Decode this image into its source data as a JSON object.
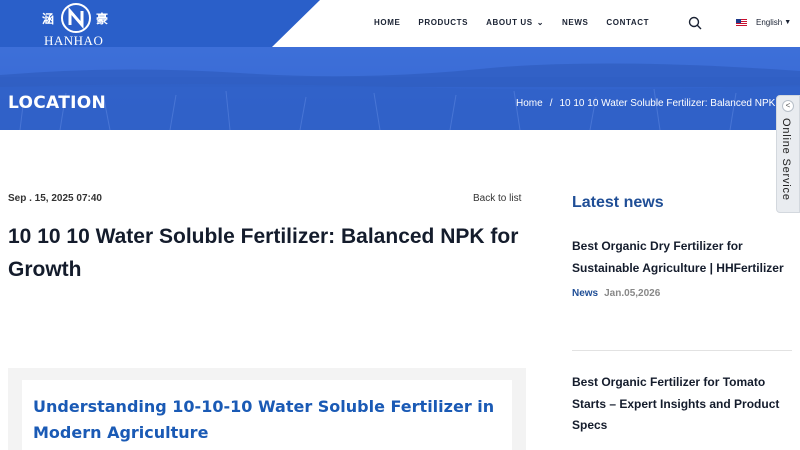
{
  "header": {
    "logo": {
      "cn_left": "涵",
      "cn_right": "豪",
      "en": "HANHAO"
    },
    "nav": [
      {
        "label": "HOME"
      },
      {
        "label": "PRODUCTS"
      },
      {
        "label": "ABOUT US",
        "has_dropdown": true
      },
      {
        "label": "NEWS"
      },
      {
        "label": "CONTACT"
      }
    ],
    "search_icon": "search-icon",
    "language": {
      "label": "English",
      "flag": "us-flag-icon"
    }
  },
  "banner": {
    "title": "LOCATION",
    "breadcrumb": {
      "home": "Home",
      "separator": "/",
      "current": "10 10 10 Water Soluble Fertilizer: Balanced NPK For Gro"
    }
  },
  "online_service": {
    "label": "Online Service",
    "arrow": "<"
  },
  "article": {
    "date": "Sep . 15, 2025 07:40",
    "back_label": "Back to list",
    "title": "10 10 10 Water Soluble Fertilizer: Balanced NPK for Growth",
    "section_heading": "Understanding 10-10-10 Water Soluble Fertilizer in Modern Agriculture"
  },
  "sidebar": {
    "title": "Latest news",
    "items": [
      {
        "title": "Best Organic Dry Fertilizer for Sustainable Agriculture | HHFertilizer",
        "tag": "News",
        "date": "Jan.05,2026"
      },
      {
        "title": "Best Organic Fertilizer for Tomato Starts – Expert Insights and Product Specs"
      }
    ]
  },
  "colors": {
    "brand_blue": "#2a5fc9",
    "banner_blue": "#3465cf",
    "heading_blue": "#1a5ab5",
    "sidebar_title": "#1f4e96"
  }
}
